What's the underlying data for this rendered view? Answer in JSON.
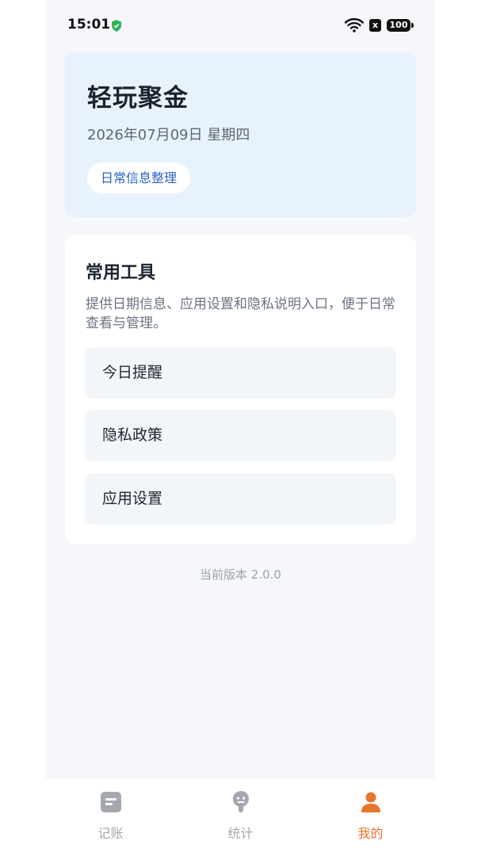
{
  "status_bar": {
    "time": "15:01",
    "battery": "100",
    "sim_badge": "x",
    "icons": [
      "shield-icon",
      "wifi-icon",
      "sim-off-icon",
      "battery-icon"
    ]
  },
  "hero": {
    "title": "轻玩聚金",
    "date": "2026年07月09日 星期四",
    "chip_label": "日常信息整理"
  },
  "tools": {
    "title": "常用工具",
    "description": "提供日期信息、应用设置和隐私说明入口，便于日常查看与管理。",
    "items": [
      {
        "label": "今日提醒"
      },
      {
        "label": "隐私政策"
      },
      {
        "label": "应用设置"
      }
    ]
  },
  "footer": {
    "version": "当前版本 2.0.0"
  },
  "tabbar": {
    "tabs": [
      {
        "label": "记账",
        "icon": "note-icon",
        "active": false
      },
      {
        "label": "统计",
        "icon": "stats-icon",
        "active": false
      },
      {
        "label": "我的",
        "icon": "person-icon",
        "active": true
      }
    ]
  },
  "colors": {
    "accent": "#e8752c",
    "hero_bg": "#e8f2fd",
    "chip_text": "#2b63c4",
    "page_bg": "#f5f7fa"
  }
}
